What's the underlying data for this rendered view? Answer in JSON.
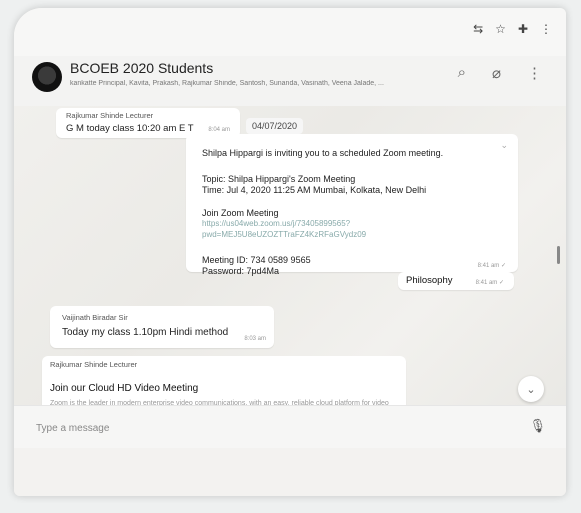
{
  "browser": {
    "icons": [
      "translate-icon",
      "star-icon",
      "extension-icon",
      "menu-icon"
    ]
  },
  "header": {
    "group_name": "BCOEB 2020 Students",
    "members": "kankatte Principal, Kavita, Prakash, Rajkumar Shinde, Santosh, Sunanda, Vasinath, Veena Jalade, ..."
  },
  "messages": [
    {
      "sender": "Rajkumar Shinde Lecturer",
      "text": "G M  today class 10:20 am E T",
      "time": "8:04 am"
    },
    {
      "zoom": {
        "line1": "Shilpa Hippargi is inviting you to a scheduled Zoom meeting.",
        "topic": "Topic: Shilpa Hippargi's Zoom Meeting",
        "time_line": "Time: Jul 4, 2020 11:25 AM Mumbai, Kolkata, New Delhi",
        "join_label": "Join Zoom Meeting",
        "link1": "https://us04web.zoom.us/j/73405899565?",
        "link2": "pwd=MEJ5U8eUZOZTTraFZ4KzRFaGVydz09",
        "meeting_id": "Meeting ID: 734 0589 9565",
        "password": "Password: 7pd4Ma",
        "time": "8:41 am ✓"
      }
    },
    {
      "text": "Philosophy",
      "time": "8:41 am ✓"
    },
    {
      "sender": "Vaijinath Biradar Sir",
      "text": "Today my class 1.10pm Hindi method",
      "time": "8:03 am"
    },
    {
      "sender": "Rajkumar Shinde Lecturer",
      "title": "Join our Cloud HD Video Meeting",
      "desc": "Zoom is the leader in modern enterprise video communications, with an easy, reliable cloud platform for video and audio conferencing, chat, and webinars across mobile,"
    }
  ],
  "date_chip": "04/07/2020",
  "composer": {
    "placeholder": "Type a message"
  }
}
